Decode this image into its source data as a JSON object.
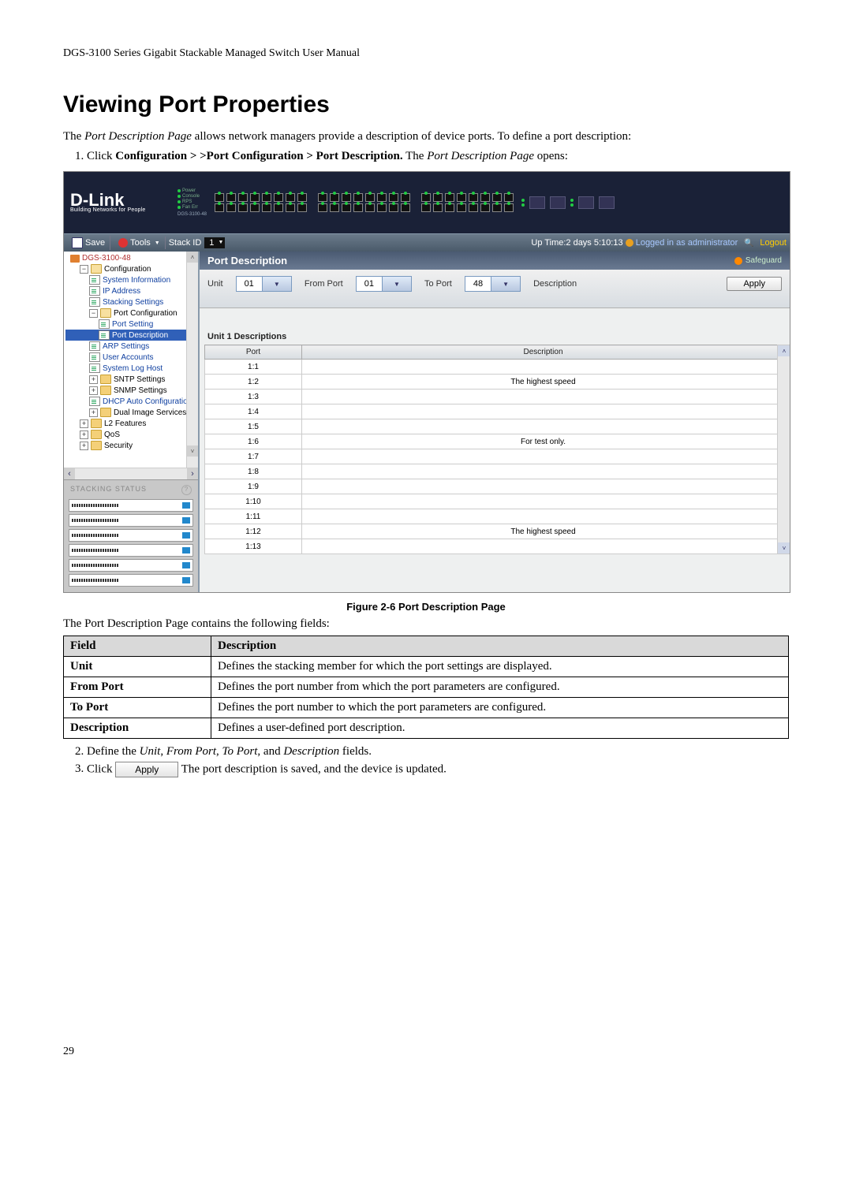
{
  "doc": {
    "header": "DGS-3100 Series Gigabit Stackable Managed Switch User Manual",
    "page_number": "29",
    "heading": "Viewing Port Properties",
    "intro_prefix": "The ",
    "intro_italic": "Port Description Page",
    "intro_suffix": " allows network managers provide a description of device ports. To define a port description:",
    "step1_a": "Click ",
    "step1_b": "Configuration > >Port Configuration > Port Description.",
    "step1_c": " The ",
    "step1_d": "Port Description Page",
    "step1_e": " opens:",
    "figure_caption": "Figure 2-6 Port Description Page",
    "after_fig": "The Port Description Page contains the following fields:",
    "step2_a": "Define the ",
    "step2_b": "Unit",
    "step2_c": ", ",
    "step2_d": "From Port",
    "step2_e": ", ",
    "step2_f": "To Port",
    "step2_g": ", and ",
    "step2_h": "Description",
    "step2_i": " fields.",
    "step3_a": "Click ",
    "step3_btn": "Apply",
    "step3_b": " The port description is saved, and the device is updated."
  },
  "field_table": {
    "h1": "Field",
    "h2": "Description",
    "rows": [
      {
        "f": "Unit",
        "d": "Defines the stacking member for which the port settings are displayed."
      },
      {
        "f": "From Port",
        "d": "Defines the port number from which the port parameters are configured."
      },
      {
        "f": "To Port",
        "d": "Defines the port number to which the port parameters are configured."
      },
      {
        "f": "Description",
        "d": "Defines a user-defined port description."
      }
    ]
  },
  "ui": {
    "brand": "D-Link",
    "tagline": "Building Networks for People",
    "model": "DGS-3100-48",
    "leds": [
      "Power",
      "Console",
      "RPS",
      "Fan Err"
    ],
    "toolbar": {
      "save": "Save",
      "tools": "Tools",
      "stack_label": "Stack ID",
      "stack_val": "1",
      "uptime": "Up Time:2 days 5:10:13",
      "logged": "Logged in as administrator",
      "logout": "Logout"
    },
    "tree": {
      "root": "DGS-3100-48",
      "configuration": "Configuration",
      "items": [
        "System Information",
        "IP Address",
        "Stacking Settings"
      ],
      "port_config": "Port Configuration",
      "port_setting": "Port Setting",
      "port_description": "Port Description",
      "items2": [
        "ARP Settings",
        "User Accounts",
        "System Log Host"
      ],
      "folders2": [
        "SNTP Settings",
        "SNMP Settings"
      ],
      "dhcp": "DHCP Auto Configuratio",
      "dual": "Dual Image Services",
      "l2": "L2 Features",
      "qos": "QoS",
      "security": "Security",
      "stacking_status": "STACKING STATUS"
    },
    "panel": {
      "title": "Port Description",
      "safeguard": "Safeguard",
      "labels": {
        "unit": "Unit",
        "from": "From Port",
        "to": "To Port",
        "desc": "Description"
      },
      "values": {
        "unit": "01",
        "from": "01",
        "to": "48"
      },
      "apply": "Apply",
      "sub": "Unit 1 Descriptions",
      "th_port": "Port",
      "th_desc": "Description",
      "rows": [
        {
          "p": "1:1",
          "d": ""
        },
        {
          "p": "1:2",
          "d": "The highest speed"
        },
        {
          "p": "1:3",
          "d": ""
        },
        {
          "p": "1:4",
          "d": ""
        },
        {
          "p": "1:5",
          "d": ""
        },
        {
          "p": "1:6",
          "d": "For test only."
        },
        {
          "p": "1:7",
          "d": ""
        },
        {
          "p": "1:8",
          "d": ""
        },
        {
          "p": "1:9",
          "d": ""
        },
        {
          "p": "1:10",
          "d": ""
        },
        {
          "p": "1:11",
          "d": ""
        },
        {
          "p": "1:12",
          "d": "The highest speed"
        },
        {
          "p": "1:13",
          "d": ""
        }
      ]
    }
  }
}
